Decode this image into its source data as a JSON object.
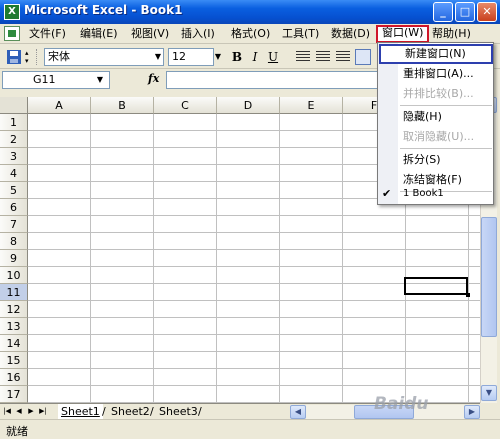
{
  "window": {
    "app_icon": "X",
    "title": "Microsoft Excel - Book1",
    "buttons": {
      "minimize": "_",
      "maximize": "□",
      "close": "✕"
    }
  },
  "menubar": {
    "items": [
      {
        "label": "文件(F)"
      },
      {
        "label": "编辑(E)"
      },
      {
        "label": "视图(V)"
      },
      {
        "label": "插入(I)"
      },
      {
        "label": "格式(O)"
      },
      {
        "label": "工具(T)"
      },
      {
        "label": "数据(D)"
      },
      {
        "label": "窗口(W)",
        "active": true
      },
      {
        "label": "帮助(H)"
      }
    ]
  },
  "toolbar": {
    "font_name": "宋体",
    "font_size": "12",
    "bold": "B",
    "italic": "I",
    "underline": "U"
  },
  "formula_bar": {
    "name_box": "G11",
    "fx": "fx",
    "formula": ""
  },
  "grid": {
    "columns": [
      "A",
      "B",
      "C",
      "D",
      "E",
      "F"
    ],
    "rows": [
      "1",
      "2",
      "3",
      "4",
      "5",
      "6",
      "7",
      "8",
      "9",
      "10",
      "11",
      "12",
      "13",
      "14",
      "15",
      "16",
      "17"
    ],
    "selected_cell": "G11",
    "selected_row": "11"
  },
  "window_menu": {
    "items": [
      {
        "label": "新建窗口(N)",
        "state": "highlighted"
      },
      {
        "label": "重排窗口(A)...",
        "state": "enabled"
      },
      {
        "label": "并排比较(B)...",
        "state": "disabled"
      },
      {
        "label": "隐藏(H)",
        "state": "enabled"
      },
      {
        "label": "取消隐藏(U)...",
        "state": "disabled"
      },
      {
        "label": "拆分(S)",
        "state": "enabled"
      },
      {
        "label": "冻结窗格(F)",
        "state": "enabled"
      },
      {
        "label": "1 Book1",
        "state": "checked"
      }
    ]
  },
  "sheet_tabs": {
    "tabs": [
      "Sheet1",
      "Sheet2",
      "Sheet3"
    ],
    "active": "Sheet1"
  },
  "status_bar": {
    "text": "就绪"
  },
  "watermark": "Baidu"
}
